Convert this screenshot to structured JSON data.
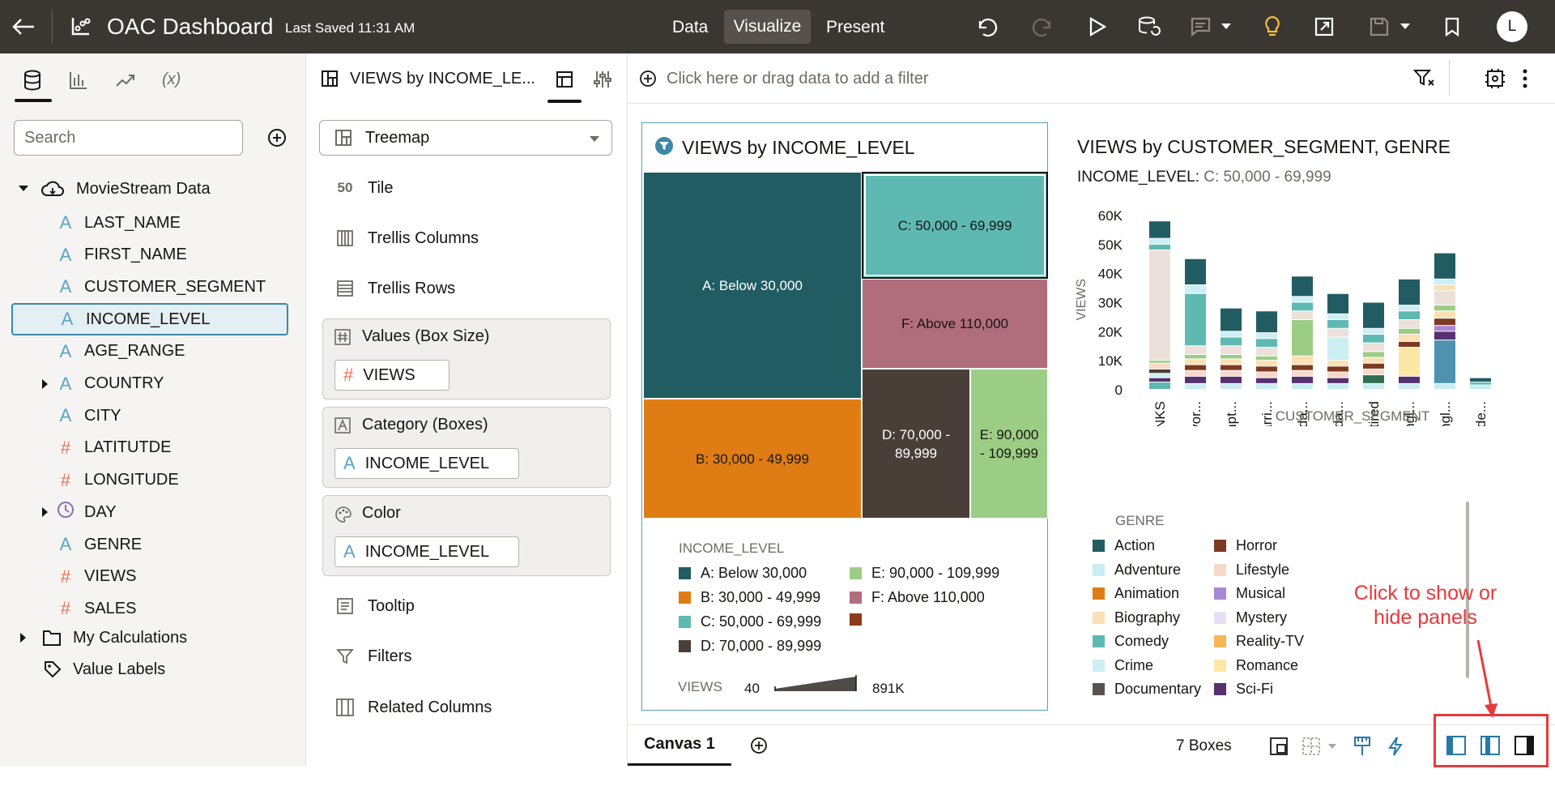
{
  "topbar": {
    "title": "OAC Dashboard",
    "last_saved": "Last Saved 11:31 AM",
    "tabs": [
      "Data",
      "Visualize",
      "Present"
    ],
    "active_tab": "Visualize",
    "avatar": "L"
  },
  "leftpanel": {
    "search_placeholder": "Search",
    "tree": {
      "root": "MovieStream Data",
      "columns": [
        {
          "label": "LAST_NAME",
          "type": "A"
        },
        {
          "label": "FIRST_NAME",
          "type": "A"
        },
        {
          "label": "CUSTOMER_SEGMENT",
          "type": "A"
        },
        {
          "label": "INCOME_LEVEL",
          "type": "A",
          "selected": true
        },
        {
          "label": "AGE_RANGE",
          "type": "A"
        },
        {
          "label": "COUNTRY",
          "type": "A",
          "expandable": true
        },
        {
          "label": "CITY",
          "type": "A"
        },
        {
          "label": "LATITUTDE",
          "type": "#"
        },
        {
          "label": "LONGITUDE",
          "type": "#"
        },
        {
          "label": "DAY",
          "type": "clock",
          "expandable": true
        },
        {
          "label": "GENRE",
          "type": "A"
        },
        {
          "label": "VIEWS",
          "type": "#"
        },
        {
          "label": "SALES",
          "type": "#"
        }
      ],
      "my_calculations": "My Calculations",
      "value_labels": "Value Labels"
    }
  },
  "grammar": {
    "header": "VIEWS by INCOME_LE...",
    "viz_type": "Treemap",
    "items_top": [
      "Tile",
      "Trellis Columns",
      "Trellis Rows"
    ],
    "drops": [
      {
        "title": "Values (Box Size)",
        "pill": "VIEWS",
        "pill_type": "#"
      },
      {
        "title": "Category (Boxes)",
        "pill": "INCOME_LEVEL",
        "pill_type": "A"
      },
      {
        "title": "Color",
        "pill": "INCOME_LEVEL",
        "pill_type": "A"
      }
    ],
    "items_bottom": [
      "Tooltip",
      "Filters",
      "Related Columns"
    ]
  },
  "filterbar": {
    "placeholder": "Click here or drag data to add a filter"
  },
  "treemap": {
    "title": "VIEWS by INCOME_LEVEL",
    "boxes": [
      {
        "label": "A: Below 30,000",
        "color": "#215c63"
      },
      {
        "label": "B: 30,000 - 49,999",
        "color": "#df7d14"
      },
      {
        "label": "C: 50,000 - 69,999",
        "color": "#5eb9b3"
      },
      {
        "label": "D: 70,000 - 89,999",
        "color": "#4a3f38"
      },
      {
        "label": "E: 90,000 - 109,999",
        "color": "#9ccd85"
      },
      {
        "label": "F: Above 110,000",
        "color": "#b06d7d"
      }
    ],
    "legend_title": "INCOME_LEVEL",
    "legend": [
      {
        "label": "A: Below 30,000",
        "color": "#215c63"
      },
      {
        "label": "B: 30,000 - 49,999",
        "color": "#df7d14"
      },
      {
        "label": "C: 50,000 - 69,999",
        "color": "#5eb9b3"
      },
      {
        "label": "D: 70,000 - 89,999",
        "color": "#4a3f38"
      },
      {
        "label": "E: 90,000 - 109,999",
        "color": "#9ccd85"
      },
      {
        "label": "F: Above 110,000",
        "color": "#b06d7d"
      },
      {
        "label": "",
        "color": "#8e3a1c"
      }
    ],
    "size_label": "VIEWS",
    "size_min": "40",
    "size_max": "891K"
  },
  "barchart": {
    "title": "VIEWS by CUSTOMER_SEGMENT, GENRE",
    "filter_label": "INCOME_LEVEL:",
    "filter_value": "C: 50,000 - 69,999",
    "legend_title": "GENRE",
    "legend": [
      {
        "label": "Action",
        "color": "#215c63"
      },
      {
        "label": "Adventure",
        "color": "#c9edf2"
      },
      {
        "label": "Animation",
        "color": "#df7d14"
      },
      {
        "label": "Biography",
        "color": "#fbe0b3"
      },
      {
        "label": "Comedy",
        "color": "#5eb9b3"
      },
      {
        "label": "Crime",
        "color": "#cdeef2"
      },
      {
        "label": "Documentary",
        "color": "#5a534d"
      },
      {
        "label": "Horror",
        "color": "#7d3a22"
      },
      {
        "label": "Lifestyle",
        "color": "#f7d8c9"
      },
      {
        "label": "Musical",
        "color": "#a988d4"
      },
      {
        "label": "Mystery",
        "color": "#e7dff5"
      },
      {
        "label": "Reality-TV",
        "color": "#f6b755"
      },
      {
        "label": "Romance",
        "color": "#fde7a5"
      },
      {
        "label": "Sci-Fi",
        "color": "#57306f"
      }
    ]
  },
  "chart_data": {
    "type": "bar",
    "stacked": true,
    "title": "VIEWS by CUSTOMER_SEGMENT, GENRE",
    "xlabel": "CUSTOMER_SEGMENT",
    "ylabel": "VIEWS",
    "categories": [
      "DINKS",
      "Divor...",
      "Empt...",
      "Marri...",
      "Mida...",
      "Mida...",
      "Retired",
      "Singl...",
      "Singl...",
      "Unde..."
    ],
    "totals": [
      58000,
      45000,
      28000,
      27000,
      39000,
      33000,
      30000,
      38000,
      47000,
      4000
    ],
    "ylim": [
      0,
      60000
    ],
    "yticks": [
      "60K",
      "50K",
      "40K",
      "30K",
      "20K",
      "10K",
      "0"
    ],
    "segments": [
      [
        {
          "v": 2500,
          "c": "#5eb9b3"
        },
        {
          "v": 1500,
          "c": "#57306f"
        },
        {
          "v": 1500,
          "c": "#cdeef2"
        },
        {
          "v": 1500,
          "c": "#4a3f38"
        },
        {
          "v": 2000,
          "c": "#f7d8c9"
        },
        {
          "v": 1000,
          "c": "#9ccd85"
        },
        {
          "v": 38000,
          "c": "#ece1da"
        },
        {
          "v": 2000,
          "c": "#5eb9b3"
        },
        {
          "v": 2000,
          "c": "#cdeef2"
        },
        {
          "v": 6000,
          "c": "#215c63"
        }
      ],
      [
        {
          "v": 2000,
          "c": "#c9edf2"
        },
        {
          "v": 2500,
          "c": "#57306f"
        },
        {
          "v": 2000,
          "c": "#f7d8c9"
        },
        {
          "v": 2000,
          "c": "#7d3a22"
        },
        {
          "v": 2000,
          "c": "#fbe0b3"
        },
        {
          "v": 1500,
          "c": "#9ccd85"
        },
        {
          "v": 3000,
          "c": "#ece1da"
        },
        {
          "v": 18000,
          "c": "#5eb9b3"
        },
        {
          "v": 3000,
          "c": "#cdeef2"
        },
        {
          "v": 9000,
          "c": "#215c63"
        }
      ],
      [
        {
          "v": 2000,
          "c": "#c9edf2"
        },
        {
          "v": 2500,
          "c": "#57306f"
        },
        {
          "v": 2000,
          "c": "#f7d8c9"
        },
        {
          "v": 2000,
          "c": "#7d3a22"
        },
        {
          "v": 2000,
          "c": "#fbe0b3"
        },
        {
          "v": 1500,
          "c": "#9ccd85"
        },
        {
          "v": 3000,
          "c": "#ece1da"
        },
        {
          "v": 3000,
          "c": "#5eb9b3"
        },
        {
          "v": 2000,
          "c": "#cdeef2"
        },
        {
          "v": 8000,
          "c": "#215c63"
        }
      ],
      [
        {
          "v": 2000,
          "c": "#c9edf2"
        },
        {
          "v": 2000,
          "c": "#57306f"
        },
        {
          "v": 2000,
          "c": "#f7d8c9"
        },
        {
          "v": 2000,
          "c": "#7d3a22"
        },
        {
          "v": 2000,
          "c": "#fbe0b3"
        },
        {
          "v": 1500,
          "c": "#9ccd85"
        },
        {
          "v": 3000,
          "c": "#ece1da"
        },
        {
          "v": 3000,
          "c": "#5eb9b3"
        },
        {
          "v": 2000,
          "c": "#cdeef2"
        },
        {
          "v": 7500,
          "c": "#215c63"
        }
      ],
      [
        {
          "v": 2000,
          "c": "#c9edf2"
        },
        {
          "v": 2500,
          "c": "#57306f"
        },
        {
          "v": 2000,
          "c": "#f7d8c9"
        },
        {
          "v": 2000,
          "c": "#7d3a22"
        },
        {
          "v": 3000,
          "c": "#fbe0b3"
        },
        {
          "v": 12500,
          "c": "#9ccd85"
        },
        {
          "v": 3000,
          "c": "#ece1da"
        },
        {
          "v": 3000,
          "c": "#5eb9b3"
        },
        {
          "v": 2000,
          "c": "#cdeef2"
        },
        {
          "v": 7000,
          "c": "#215c63"
        }
      ],
      [
        {
          "v": 2000,
          "c": "#c9edf2"
        },
        {
          "v": 2000,
          "c": "#57306f"
        },
        {
          "v": 2000,
          "c": "#f7d8c9"
        },
        {
          "v": 2000,
          "c": "#7d3a22"
        },
        {
          "v": 2000,
          "c": "#fbe0b3"
        },
        {
          "v": 8000,
          "c": "#cdeef2"
        },
        {
          "v": 3000,
          "c": "#ece1da"
        },
        {
          "v": 3000,
          "c": "#5eb9b3"
        },
        {
          "v": 2000,
          "c": "#cdeef2"
        },
        {
          "v": 7000,
          "c": "#215c63"
        }
      ],
      [
        {
          "v": 2000,
          "c": "#c9edf2"
        },
        {
          "v": 3000,
          "c": "#2f6f4f"
        },
        {
          "v": 2000,
          "c": "#f7d8c9"
        },
        {
          "v": 2000,
          "c": "#7d3a22"
        },
        {
          "v": 2000,
          "c": "#fbe0b3"
        },
        {
          "v": 2000,
          "c": "#9ccd85"
        },
        {
          "v": 3000,
          "c": "#ece1da"
        },
        {
          "v": 3000,
          "c": "#5eb9b3"
        },
        {
          "v": 2000,
          "c": "#cdeef2"
        },
        {
          "v": 9000,
          "c": "#215c63"
        }
      ],
      [
        {
          "v": 2000,
          "c": "#c9edf2"
        },
        {
          "v": 2500,
          "c": "#57306f"
        },
        {
          "v": 10000,
          "c": "#fde7a5"
        },
        {
          "v": 2000,
          "c": "#7d3a22"
        },
        {
          "v": 2500,
          "c": "#fbe0b3"
        },
        {
          "v": 2000,
          "c": "#9ccd85"
        },
        {
          "v": 3000,
          "c": "#ece1da"
        },
        {
          "v": 3000,
          "c": "#5eb9b3"
        },
        {
          "v": 2000,
          "c": "#cdeef2"
        },
        {
          "v": 9000,
          "c": "#215c63"
        }
      ],
      [
        {
          "v": 2000,
          "c": "#c9edf2"
        },
        {
          "v": 15000,
          "c": "#4f92b0"
        },
        {
          "v": 3000,
          "c": "#57306f"
        },
        {
          "v": 2000,
          "c": "#a988d4"
        },
        {
          "v": 2500,
          "c": "#7d3a22"
        },
        {
          "v": 2500,
          "c": "#fbe0b3"
        },
        {
          "v": 2000,
          "c": "#9ccd85"
        },
        {
          "v": 5000,
          "c": "#ece1da"
        },
        {
          "v": 2000,
          "c": "#fbe0b3"
        },
        {
          "v": 2000,
          "c": "#cdeef2"
        },
        {
          "v": 9000,
          "c": "#215c63"
        }
      ],
      [
        {
          "v": 1500,
          "c": "#c9edf2"
        },
        {
          "v": 1000,
          "c": "#5eb9b3"
        },
        {
          "v": 1500,
          "c": "#215c63"
        }
      ]
    ]
  },
  "footer": {
    "canvas_tab": "Canvas 1",
    "boxes_count": "7 Boxes"
  },
  "annotation": {
    "text_line1": "Click to show or",
    "text_line2": "hide panels",
    "color": "#e8393a"
  }
}
